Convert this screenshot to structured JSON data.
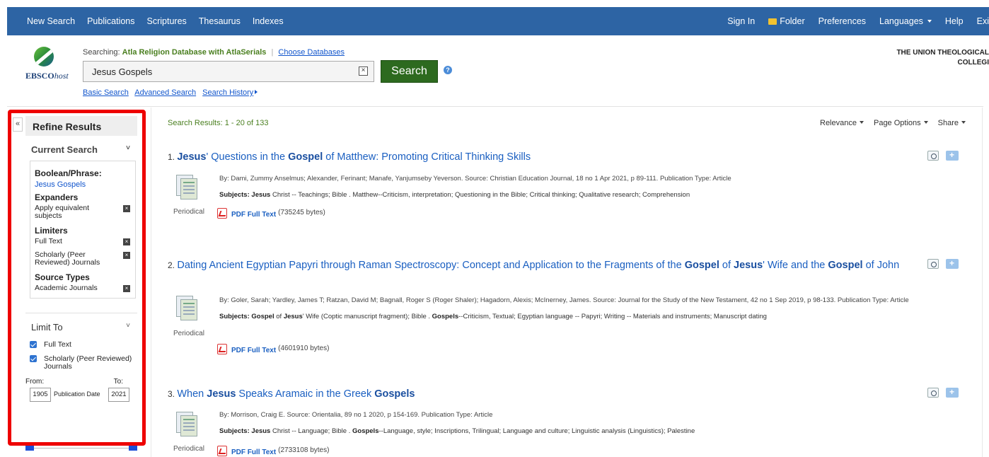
{
  "topnav": {
    "left": [
      "New Search",
      "Publications",
      "Scriptures",
      "Thesaurus",
      "Indexes"
    ],
    "right": {
      "sign_in": "Sign In",
      "folder": "Folder",
      "preferences": "Preferences",
      "languages": "Languages",
      "help": "Help",
      "exit": "Exi"
    }
  },
  "header": {
    "logo_text": "EBSCO",
    "logo_text_italic": "host",
    "searching_label": "Searching:",
    "database": "Atla Religion Database with AtlaSerials",
    "choose_databases": "Choose Databases",
    "search_value": "Jesus Gospels",
    "clear_glyph": "×",
    "search_button": "Search",
    "help_glyph": "?",
    "links": [
      "Basic Search",
      "Advanced Search",
      "Search History"
    ],
    "institution_line1": "THE UNION THEOLOGICAL",
    "institution_line2": "COLLEGI"
  },
  "sidebar": {
    "collapse_glyph": "«",
    "title": "Refine Results",
    "current_search": "Current Search",
    "boolean_label": "Boolean/Phrase:",
    "boolean_value": "Jesus Gospels",
    "expanders_label": "Expanders",
    "expanders": [
      "Apply equivalent subjects"
    ],
    "limiters_label": "Limiters",
    "limiters": [
      "Full Text",
      "Scholarly (Peer Reviewed) Journals"
    ],
    "source_types_label": "Source Types",
    "source_types": [
      "Academic Journals"
    ],
    "limit_to": "Limit To",
    "limit_checks": [
      "Full Text",
      "Scholarly (Peer Reviewed) Journals"
    ],
    "from_label": "From:",
    "to_label": "To:",
    "from_value": "1905",
    "to_value": "2021",
    "date_label": "Publication Date"
  },
  "results_bar": {
    "count": "Search Results: 1 - 20 of 133",
    "relevance": "Relevance",
    "page_options": "Page Options",
    "share": "Share"
  },
  "results": [
    {
      "num": "1.",
      "title_parts": [
        {
          "t": "Jesus",
          "b": true
        },
        {
          "t": "' Questions in the ",
          "b": false
        },
        {
          "t": "Gospel",
          "b": true
        },
        {
          "t": " of Matthew: Promoting Critical Thinking Skills",
          "b": false
        }
      ],
      "meta": "By: Dami, Zummy Anselmus; Alexander, Ferinant; Manafe, Yanjumseby Yeverson. Source: Christian Education Journal, 18 no 1 Apr 2021, p 89-111. Publication Type: Article",
      "subjects_label": "Subjects:",
      "subjects_parts": [
        {
          "t": " ",
          "b": false
        },
        {
          "t": "Jesus",
          "b": true
        },
        {
          "t": " Christ -- Teachings; Bible . Matthew--Criticism, interpretation; Questioning in the Bible; Critical thinking; Qualitative research; Comprehension",
          "b": false
        }
      ],
      "type": "Periodical",
      "pdf": "PDF Full Text",
      "bytes": "(735245 bytes)"
    },
    {
      "num": "2.",
      "title_parts": [
        {
          "t": "Dating Ancient Egyptian Papyri through Raman Spectroscopy: Concept and Application to the Fragments of the ",
          "b": false
        },
        {
          "t": "Gospel",
          "b": true
        },
        {
          "t": " of ",
          "b": false
        },
        {
          "t": "Jesus",
          "b": true
        },
        {
          "t": "' Wife and the ",
          "b": false
        },
        {
          "t": "Gospel",
          "b": true
        },
        {
          "t": " of John",
          "b": false
        }
      ],
      "meta": "By: Goler, Sarah; Yardley, James T; Ratzan, David M; Bagnall, Roger S (Roger Shaler); Hagadorn, Alexis; McInerney, James. Source: Journal for the Study of the New Testament, 42 no 1 Sep 2019, p 98-133. Publication Type: Article",
      "subjects_label": "Subjects:",
      "subjects_parts": [
        {
          "t": " ",
          "b": false
        },
        {
          "t": "Gospel",
          "b": true
        },
        {
          "t": " of ",
          "b": false
        },
        {
          "t": "Jesus",
          "b": true
        },
        {
          "t": "' Wife (Coptic manuscript fragment); Bible . ",
          "b": false
        },
        {
          "t": "Gospels",
          "b": true
        },
        {
          "t": "--Criticism, Textual; Egyptian language -- Papyri; Writing -- Materials and instruments; Manuscript dating",
          "b": false
        }
      ],
      "type": "Periodical",
      "pdf": "PDF Full Text",
      "bytes": "(4601910 bytes)"
    },
    {
      "num": "3.",
      "title_parts": [
        {
          "t": "When ",
          "b": false
        },
        {
          "t": "Jesus",
          "b": true
        },
        {
          "t": " Speaks Aramaic in the Greek ",
          "b": false
        },
        {
          "t": "Gospels",
          "b": true
        }
      ],
      "meta": "By: Morrison, Craig E. Source: Orientalia, 89 no 1 2020, p 154-169. Publication Type: Article",
      "subjects_label": "Subjects:",
      "subjects_parts": [
        {
          "t": " ",
          "b": false
        },
        {
          "t": "Jesus",
          "b": true
        },
        {
          "t": " Christ -- Language; Bible . ",
          "b": false
        },
        {
          "t": "Gospels",
          "b": true
        },
        {
          "t": "--Language, style; Inscriptions, Trilingual; Language and culture; Linguistic analysis (Linguistics); Palestine",
          "b": false
        }
      ],
      "type": "Periodical",
      "pdf": "PDF Full Text",
      "bytes": "(2733108 bytes)"
    }
  ]
}
